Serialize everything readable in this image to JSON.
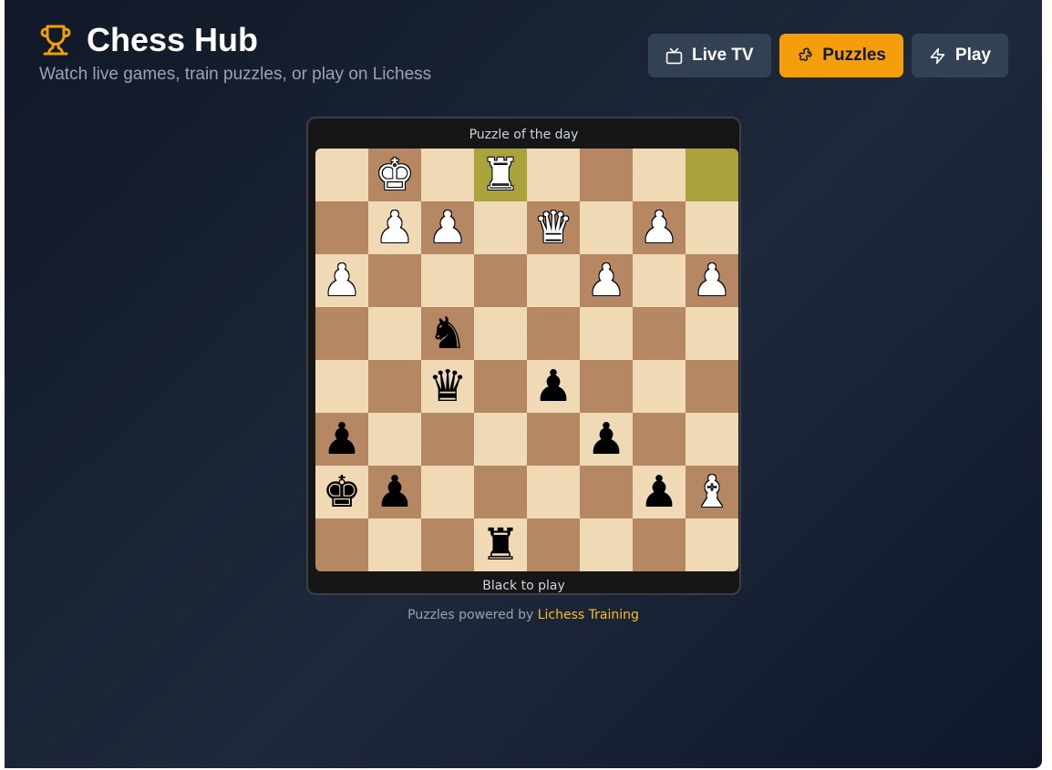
{
  "header": {
    "title": "Chess Hub",
    "subtitle": "Watch live games, train puzzles, or play on Lichess",
    "icon": "trophy-icon"
  },
  "nav": [
    {
      "label": "Live TV",
      "icon": "tv-icon",
      "active": false
    },
    {
      "label": "Puzzles",
      "icon": "puzzle-icon",
      "active": true
    },
    {
      "label": "Play",
      "icon": "lightning-icon",
      "active": false
    }
  ],
  "puzzle": {
    "heading": "Puzzle of the day",
    "to_move": "Black to play",
    "highlighted_squares": [
      "d8",
      "h8"
    ],
    "ranks": [
      [
        "",
        "wK",
        "",
        "wR",
        "",
        "",
        "",
        ""
      ],
      [
        "",
        "wP",
        "wP",
        "",
        "wQ",
        "",
        "wP",
        ""
      ],
      [
        "wP",
        "",
        "",
        "",
        "",
        "wP",
        "",
        "wP"
      ],
      [
        "",
        "",
        "bN",
        "",
        "",
        "",
        "",
        ""
      ],
      [
        "",
        "",
        "bQ",
        "",
        "bP",
        "",
        "",
        ""
      ],
      [
        "bP",
        "",
        "",
        "",
        "",
        "bP",
        "",
        ""
      ],
      [
        "bK",
        "bP",
        "",
        "",
        "",
        "",
        "bP",
        "wB"
      ],
      [
        "",
        "",
        "",
        "bR",
        "",
        "",
        "",
        ""
      ]
    ]
  },
  "footer": {
    "prefix": "Puzzles powered by ",
    "link": "Lichess Training"
  },
  "colors": {
    "accent": "#f59e0b",
    "light_square": "#f0d9b5",
    "dark_square": "#b58863",
    "highlight": "#aaa23a"
  }
}
